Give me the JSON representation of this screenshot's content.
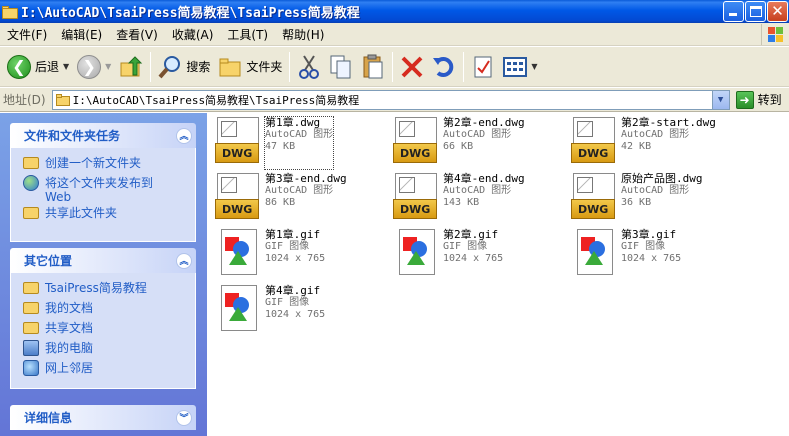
{
  "window": {
    "title": "I:\\AutoCAD\\TsaiPress简易教程\\TsaiPress简易教程"
  },
  "menu": [
    "文件(F)",
    "编辑(E)",
    "查看(V)",
    "收藏(A)",
    "工具(T)",
    "帮助(H)"
  ],
  "toolbar": {
    "back_label": "后退",
    "search_label": "搜索",
    "folders_label": "文件夹"
  },
  "address": {
    "label": "地址(D)",
    "value": "I:\\AutoCAD\\TsaiPress简易教程\\TsaiPress简易教程",
    "go_label": "转到"
  },
  "panels": {
    "tasks": {
      "title": "文件和文件夹任务",
      "items": [
        "创建一个新文件夹",
        "将这个文件夹发布到 Web",
        "共享此文件夹"
      ]
    },
    "places": {
      "title": "其它位置",
      "items": [
        "TsaiPress简易教程",
        "我的文档",
        "共享文档",
        "我的电脑",
        "网上邻居"
      ]
    },
    "details": {
      "title": "详细信息"
    }
  },
  "files": [
    {
      "name": "第1章.dwg",
      "type": "AutoCAD 图形",
      "size": "47 KB",
      "icon": "dwg-icon"
    },
    {
      "name": "第2章-end.dwg",
      "type": "AutoCAD 图形",
      "size": "66 KB",
      "icon": "dwg-icon"
    },
    {
      "name": "第2章-start.dwg",
      "type": "AutoCAD 图形",
      "size": "42 KB",
      "icon": "dwg-icon"
    },
    {
      "name": "第3章-end.dwg",
      "type": "AutoCAD 图形",
      "size": "86 KB",
      "icon": "dwg-icon"
    },
    {
      "name": "第4章-end.dwg",
      "type": "AutoCAD 图形",
      "size": "143 KB",
      "icon": "dwg-icon"
    },
    {
      "name": "原始产品图.dwg",
      "type": "AutoCAD 图形",
      "size": "36 KB",
      "icon": "dwg-icon"
    },
    {
      "name": "第1章.gif",
      "type": "GIF 图像",
      "size": "1024 x 765",
      "icon": "gif-icon"
    },
    {
      "name": "第2章.gif",
      "type": "GIF 图像",
      "size": "1024 x 765",
      "icon": "gif-icon"
    },
    {
      "name": "第3章.gif",
      "type": "GIF 图像",
      "size": "1024 x 765",
      "icon": "gif-icon"
    },
    {
      "name": "第4章.gif",
      "type": "GIF 图像",
      "size": "1024 x 765",
      "icon": "gif-icon"
    }
  ]
}
